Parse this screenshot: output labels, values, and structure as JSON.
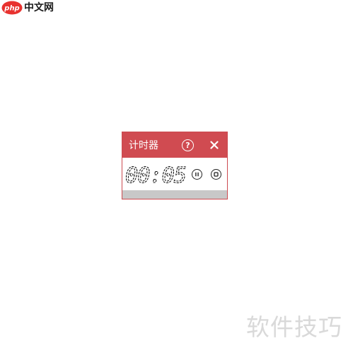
{
  "logo": {
    "badge_text": "php",
    "text": "中文网"
  },
  "timer": {
    "title": "计时器",
    "help_symbol": "?",
    "time_value": "00:05",
    "buttons": {
      "help": "help-icon",
      "close": "close-icon",
      "pause": "pause-icon",
      "stop": "stop-icon"
    }
  },
  "watermark": {
    "text": "软件技巧"
  },
  "colors": {
    "title_bar": "#d04b51",
    "status_strip": "#c8c8c8",
    "watermark": "#d9d9d9",
    "logo_badge": "#e8322f"
  }
}
